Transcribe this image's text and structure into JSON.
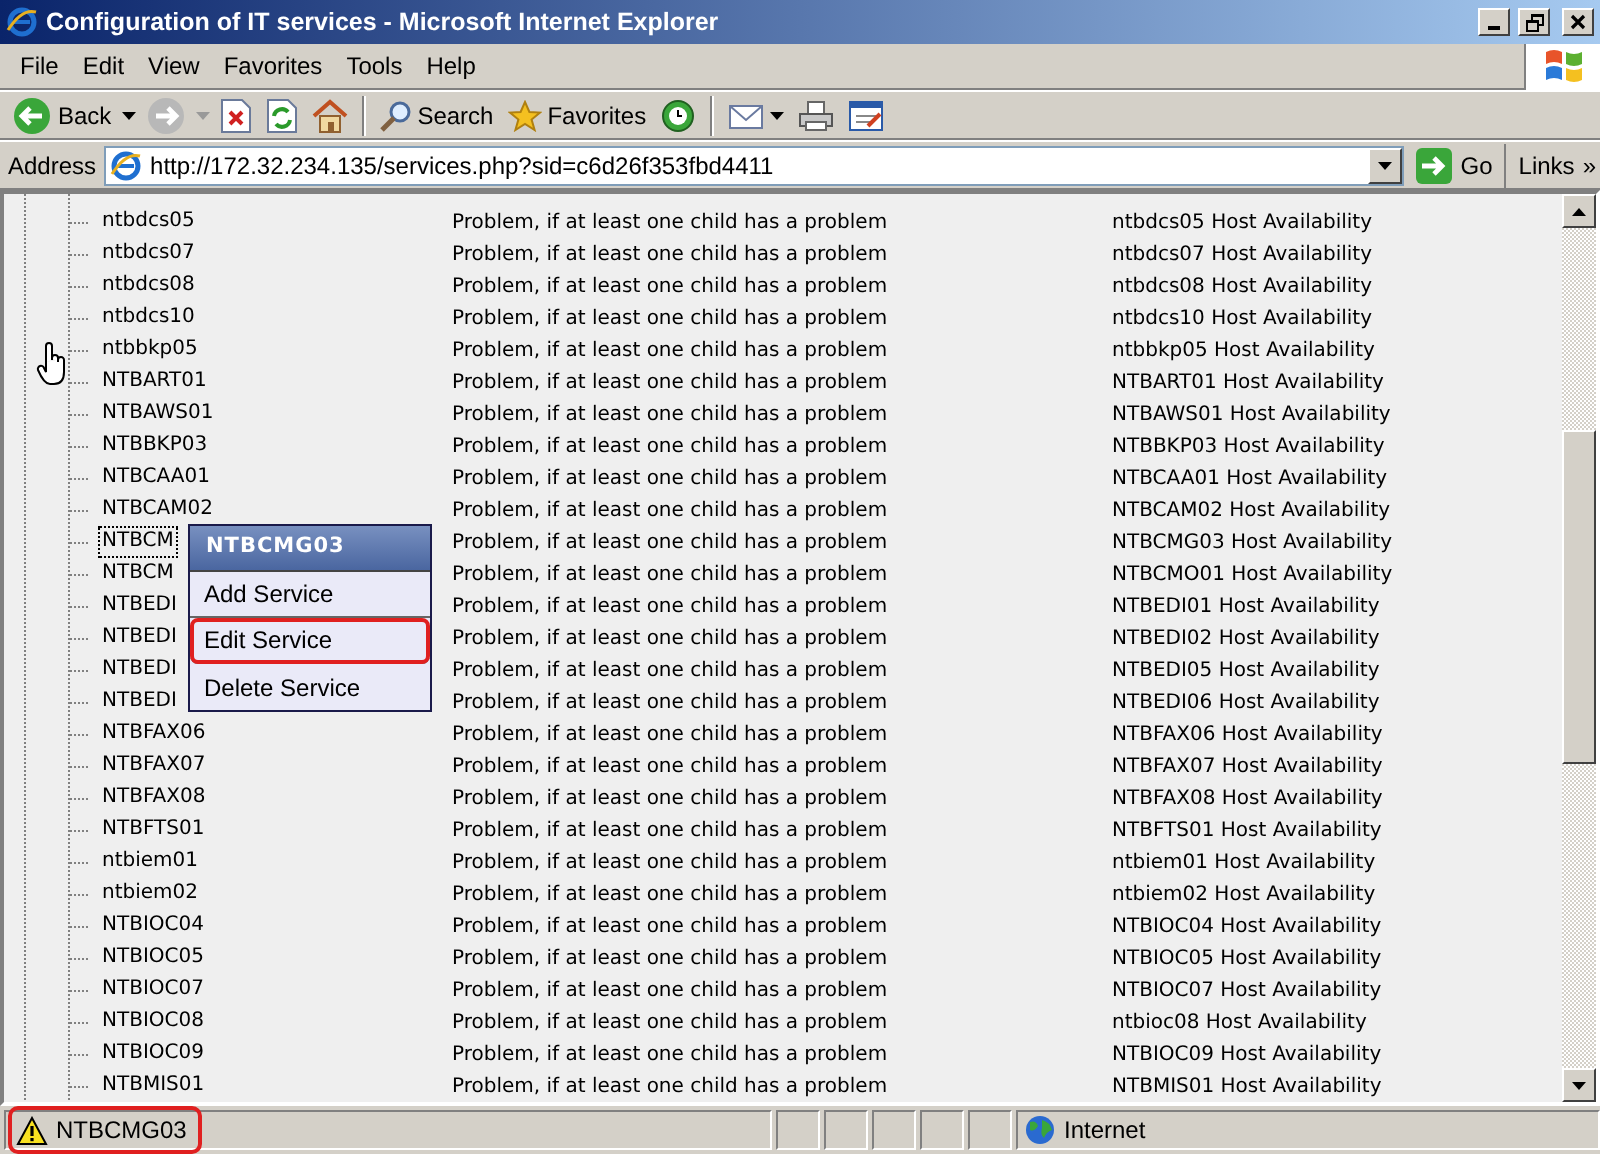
{
  "window": {
    "title": "Configuration of IT services - Microsoft Internet Explorer"
  },
  "menu": [
    "File",
    "Edit",
    "View",
    "Favorites",
    "Tools",
    "Help"
  ],
  "toolbar": {
    "back": {
      "label": "Back"
    },
    "forward": {
      "disabled": true
    },
    "search": {
      "label": "Search"
    },
    "favorites": {
      "label": "Favorites"
    }
  },
  "address": {
    "label": "Address",
    "url": "http://172.32.234.135/services.php?sid=c6d26f353fbd4411",
    "go": "Go",
    "links": "Links",
    "chevron": "»"
  },
  "services": [
    {
      "name": "ntbdcs05",
      "rule": "Problem, if at least one child has a problem",
      "host": "ntbdcs05 Host Availability",
      "focused": false
    },
    {
      "name": "ntbdcs07",
      "rule": "Problem, if at least one child has a problem",
      "host": "ntbdcs07 Host Availability",
      "focused": false
    },
    {
      "name": "ntbdcs08",
      "rule": "Problem, if at least one child has a problem",
      "host": "ntbdcs08 Host Availability",
      "focused": false
    },
    {
      "name": "ntbdcs10",
      "rule": "Problem, if at least one child has a problem",
      "host": "ntbdcs10 Host Availability",
      "focused": false
    },
    {
      "name": "ntbbkp05",
      "rule": "Problem, if at least one child has a problem",
      "host": "ntbbkp05 Host Availability",
      "focused": false
    },
    {
      "name": "NTBART01",
      "rule": "Problem, if at least one child has a problem",
      "host": "NTBART01 Host Availability",
      "focused": false
    },
    {
      "name": "NTBAWS01",
      "rule": "Problem, if at least one child has a problem",
      "host": "NTBAWS01 Host Availability",
      "focused": false
    },
    {
      "name": "NTBBKP03",
      "rule": "Problem, if at least one child has a problem",
      "host": "NTBBKP03 Host Availability",
      "focused": false
    },
    {
      "name": "NTBCAA01",
      "rule": "Problem, if at least one child has a problem",
      "host": "NTBCAA01 Host Availability",
      "focused": false
    },
    {
      "name": "NTBCAM02",
      "rule": "Problem, if at least one child has a problem",
      "host": "NTBCAM02 Host Availability",
      "focused": false
    },
    {
      "name": "NTBCM",
      "rule": "Problem, if at least one child has a problem",
      "host": "NTBCMG03 Host Availability",
      "focused": true
    },
    {
      "name": "NTBCM",
      "rule": "Problem, if at least one child has a problem",
      "host": "NTBCMO01 Host Availability",
      "focused": false
    },
    {
      "name": "NTBEDI",
      "rule": "Problem, if at least one child has a problem",
      "host": "NTBEDI01 Host Availability",
      "focused": false
    },
    {
      "name": "NTBEDI",
      "rule": "Problem, if at least one child has a problem",
      "host": "NTBEDI02 Host Availability",
      "focused": false
    },
    {
      "name": "NTBEDI",
      "rule": "Problem, if at least one child has a problem",
      "host": "NTBEDI05 Host Availability",
      "focused": false
    },
    {
      "name": "NTBEDI",
      "rule": "Problem, if at least one child has a problem",
      "host": "NTBEDI06 Host Availability",
      "focused": false
    },
    {
      "name": "NTBFAX06",
      "rule": "Problem, if at least one child has a problem",
      "host": "NTBFAX06 Host Availability",
      "focused": false
    },
    {
      "name": "NTBFAX07",
      "rule": "Problem, if at least one child has a problem",
      "host": "NTBFAX07 Host Availability",
      "focused": false
    },
    {
      "name": "NTBFAX08",
      "rule": "Problem, if at least one child has a problem",
      "host": "NTBFAX08 Host Availability",
      "focused": false
    },
    {
      "name": "NTBFTS01",
      "rule": "Problem, if at least one child has a problem",
      "host": "NTBFTS01 Host Availability",
      "focused": false
    },
    {
      "name": "ntbiem01",
      "rule": "Problem, if at least one child has a problem",
      "host": "ntbiem01 Host Availability",
      "focused": false
    },
    {
      "name": "ntbiem02",
      "rule": "Problem, if at least one child has a problem",
      "host": "ntbiem02 Host Availability",
      "focused": false
    },
    {
      "name": "NTBIOC04",
      "rule": "Problem, if at least one child has a problem",
      "host": "NTBIOC04 Host Availability",
      "focused": false
    },
    {
      "name": "NTBIOC05",
      "rule": "Problem, if at least one child has a problem",
      "host": "NTBIOC05 Host Availability",
      "focused": false
    },
    {
      "name": "NTBIOC07",
      "rule": "Problem, if at least one child has a problem",
      "host": "NTBIOC07 Host Availability",
      "focused": false
    },
    {
      "name": "NTBIOC08",
      "rule": "Problem, if at least one child has a problem",
      "host": "ntbioc08 Host Availability",
      "focused": false
    },
    {
      "name": "NTBIOC09",
      "rule": "Problem, if at least one child has a problem",
      "host": "NTBIOC09 Host Availability",
      "focused": false
    },
    {
      "name": "NTBMIS01",
      "rule": "Problem, if at least one child has a problem",
      "host": "NTBMIS01 Host Availability",
      "focused": false
    }
  ],
  "context_menu": {
    "title": "NTBCMG03",
    "items": [
      {
        "label": "Add Service",
        "highlighted": false
      },
      {
        "label": "Edit Service",
        "highlighted": true
      },
      {
        "label": "Delete Service",
        "highlighted": false
      }
    ]
  },
  "status_bar": {
    "text": "NTBCMG03",
    "highlighted": true,
    "zone": "Internet"
  }
}
